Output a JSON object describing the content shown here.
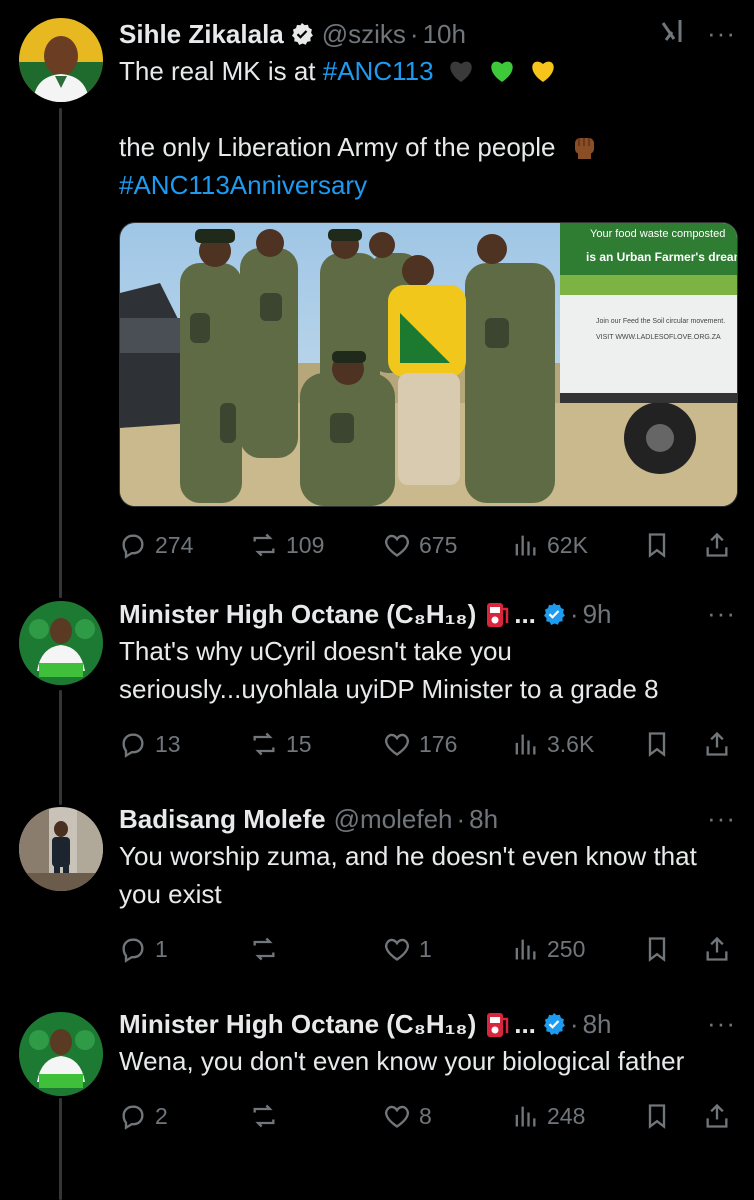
{
  "tweets": [
    {
      "name": "Sihle Zikalala",
      "handle": "@sziks",
      "time": "10h",
      "line1": "The real MK is at ",
      "hashtag1": "#ANC113",
      "line2": "the only Liberation Army of the people",
      "hashtag2": "#ANC113Anniversary",
      "image_text": {
        "sign_line1": "Your food waste composted",
        "sign_line2": "is an Urban Farmer's dream.",
        "sign_line3": "Join our Feed the Soil circular movement.",
        "sign_line4": "VISIT WWW.LADLESOFLOVE.ORG.ZA"
      },
      "replies": "274",
      "reposts": "109",
      "likes": "675",
      "views": "62K"
    },
    {
      "name": "Minister High Octane (C₈H₁₈)",
      "ellipsis": "...",
      "time": "9h",
      "text": "That's why uCyril doesn't take you seriously...uyohlala uyiDP Minister to a grade 8",
      "replies": "13",
      "reposts": "15",
      "likes": "176",
      "views": "3.6K"
    },
    {
      "name": "Badisang Molefe",
      "handle": "@molefeh",
      "time": "8h",
      "text": "You worship zuma, and he doesn't even know that you exist",
      "replies": "1",
      "reposts": "",
      "likes": "1",
      "views": "250"
    },
    {
      "name": "Minister High Octane (C₈H₁₈)",
      "ellipsis": "...",
      "time": "8h",
      "text": "Wena, you don't even know your biological father",
      "replies": "2",
      "reposts": "",
      "likes": "8",
      "views": "248"
    }
  ],
  "ui": {
    "dot": "·",
    "more": "···"
  },
  "colors": {
    "accent": "#1d9bf0",
    "muted": "#71767b",
    "background": "#000000",
    "text": "#e7e9ea"
  }
}
